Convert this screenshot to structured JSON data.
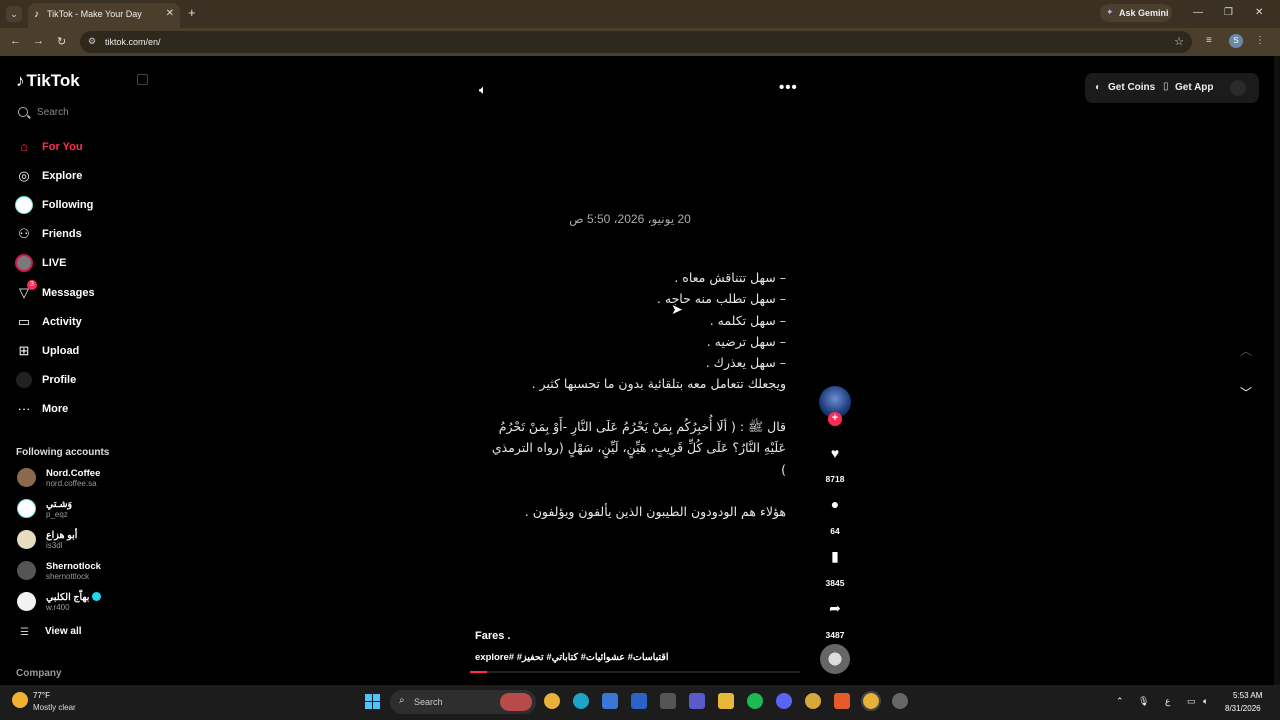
{
  "browser": {
    "tab_title": "TikTok - Make Your Day",
    "tab_close": "✕",
    "new_tab": "+",
    "url": "tiktok.com/en/",
    "gemini_label": "Ask Gemini",
    "profile_initial": "S",
    "window_controls": [
      "—",
      "❐",
      "✕"
    ]
  },
  "sidebar": {
    "logo": "TikTok",
    "search_placeholder": "Search",
    "nav": [
      {
        "label": "For You",
        "icon": "home-icon",
        "active": true
      },
      {
        "label": "Explore",
        "icon": "compass-icon"
      },
      {
        "label": "Following",
        "icon": "following-avatar"
      },
      {
        "label": "Friends",
        "icon": "friends-icon"
      },
      {
        "label": "LIVE",
        "icon": "live-avatar"
      },
      {
        "label": "Messages",
        "icon": "messages-icon",
        "badge": "3"
      },
      {
        "label": "Activity",
        "icon": "activity-icon"
      },
      {
        "label": "Upload",
        "icon": "upload-icon"
      },
      {
        "label": "Profile",
        "icon": "profile-avatar"
      },
      {
        "label": "More",
        "icon": "more-icon"
      }
    ],
    "following_title": "Following accounts",
    "accounts": [
      {
        "name": "Nord.Coffee",
        "handle": "nord.coffee.sa"
      },
      {
        "name": "وَشـتي",
        "handle": "p_eqz"
      },
      {
        "name": "أبو هزاع",
        "handle": "is3dl"
      },
      {
        "name": "Shernotlock",
        "handle": "shernottlock"
      },
      {
        "name": "بهاّج الكلبي",
        "handle": "w.r400",
        "verified": true
      }
    ],
    "view_all": "View all",
    "company": "Company"
  },
  "topbar": {
    "coins": "Get Coins",
    "app": "Get App"
  },
  "video": {
    "date": "20 يونيو، 2026، 5:50 ص",
    "lines": [
      "–   سهل تتناقش معاه .",
      "–   سهل تطلب منه حاجه .",
      "–   سهل تكلمه .",
      "–   سهل ترضيه .",
      "–   سهل يعذرك .",
      "ويجعلك تتعامل معه بتلقائية بدون ما تحسبها كثير .",
      "",
      "قال ﷺ : ( ألَا أُخبِرُكُم بِمَنْ يَحْرُمُ عَلَى النَّارِ -أَوْ بِمَنْ تَحْرُمُ",
      "عَلَيْهِ النَّارُ؟ عَلَى كُلِّ قَرِيبٍ، هَيِّنٍ، لَيِّنٍ، سَهْلٍ (رواه الترمذي )",
      "",
      "هؤلاء هم الودودون الطيبون الذين يألفون ويؤلفون ."
    ],
    "author": "Fares .",
    "hashtags": "اقتباسات# عشوائيات# كتاباتي# تحفيز# #explore",
    "progress": 0.05
  },
  "actions": {
    "likes": "8718",
    "comments": "64",
    "saves": "3845",
    "shares": "3487",
    "follow_plus": "+"
  },
  "taskbar": {
    "weather_temp": "77°F",
    "weather_desc": "Mostly clear",
    "search_label": "Search",
    "lang": "ع",
    "time": "5:53 AM",
    "date": "8/31/2026"
  }
}
